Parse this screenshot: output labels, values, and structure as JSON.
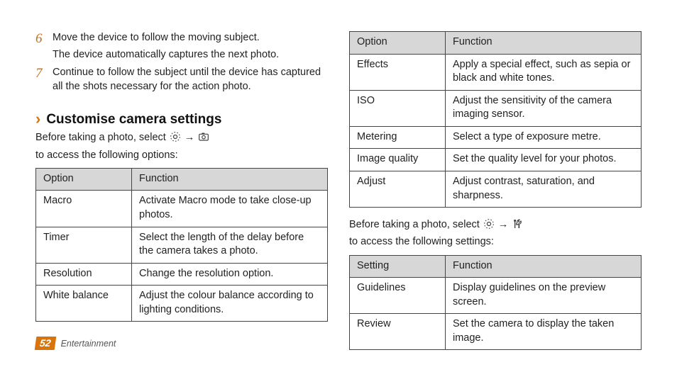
{
  "steps": [
    {
      "n": "6",
      "lines": [
        "Move the device to follow the moving subject.",
        "The device automatically captures the next photo."
      ]
    },
    {
      "n": "7",
      "lines": [
        "Continue to follow the subject until the device has captured all the shots necessary for the action photo."
      ]
    }
  ],
  "heading": "Customise camera settings",
  "intro1_a": "Before taking a photo, select",
  "intro1_b": "to access the following options:",
  "arrow": "→",
  "table1": {
    "h1": "Option",
    "h2": "Function",
    "rows": [
      {
        "o": "Macro",
        "f": "Activate Macro mode to take close-up photos."
      },
      {
        "o": "Timer",
        "f": "Select the length of the delay before the camera takes a photo."
      },
      {
        "o": "Resolution",
        "f": "Change the resolution option."
      },
      {
        "o": "White balance",
        "f": "Adjust the colour balance according to lighting conditions."
      }
    ]
  },
  "table2": {
    "h1": "Option",
    "h2": "Function",
    "rows": [
      {
        "o": "Effects",
        "f": "Apply a special effect, such as sepia or black and white tones."
      },
      {
        "o": "ISO",
        "f": "Adjust the sensitivity of the camera imaging sensor."
      },
      {
        "o": "Metering",
        "f": "Select a type of exposure metre."
      },
      {
        "o": "Image quality",
        "f": "Set the quality level for your photos."
      },
      {
        "o": "Adjust",
        "f": "Adjust contrast, saturation, and sharpness."
      }
    ]
  },
  "intro2_a": "Before taking a photo, select",
  "intro2_b": "to access the following settings:",
  "table3": {
    "h1": "Setting",
    "h2": "Function",
    "rows": [
      {
        "o": "Guidelines",
        "f": "Display guidelines on the preview screen."
      },
      {
        "o": "Review",
        "f": "Set the camera to display the taken image."
      }
    ]
  },
  "footer": {
    "page": "52",
    "section": "Entertainment"
  }
}
